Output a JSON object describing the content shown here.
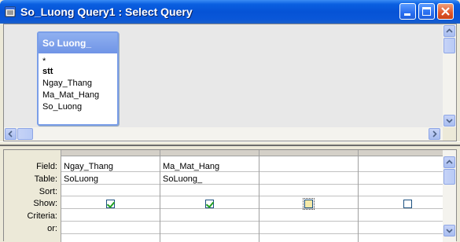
{
  "window": {
    "title": "So_Luong Query1 : Select Query"
  },
  "table": {
    "title": "So Luong_",
    "fields": [
      "*",
      "stt",
      "Ngay_Thang",
      "Ma_Mat_Hang",
      "So_Luong"
    ]
  },
  "grid": {
    "row_labels": [
      "Field:",
      "Table:",
      "Sort:",
      "Show:",
      "Criteria:",
      "or:"
    ],
    "columns": [
      {
        "field": "Ngay_Thang",
        "table": "SoLuong",
        "show": true
      },
      {
        "field": "Ma_Mat_Hang",
        "table": "SoLuong_",
        "show": true
      },
      {
        "field": "",
        "table": "",
        "show": false
      },
      {
        "field": "",
        "table": "",
        "show": false
      }
    ]
  },
  "colors": {
    "titlebar": "#0653d6",
    "table_header": "#7094e6",
    "check": "#21a121"
  }
}
